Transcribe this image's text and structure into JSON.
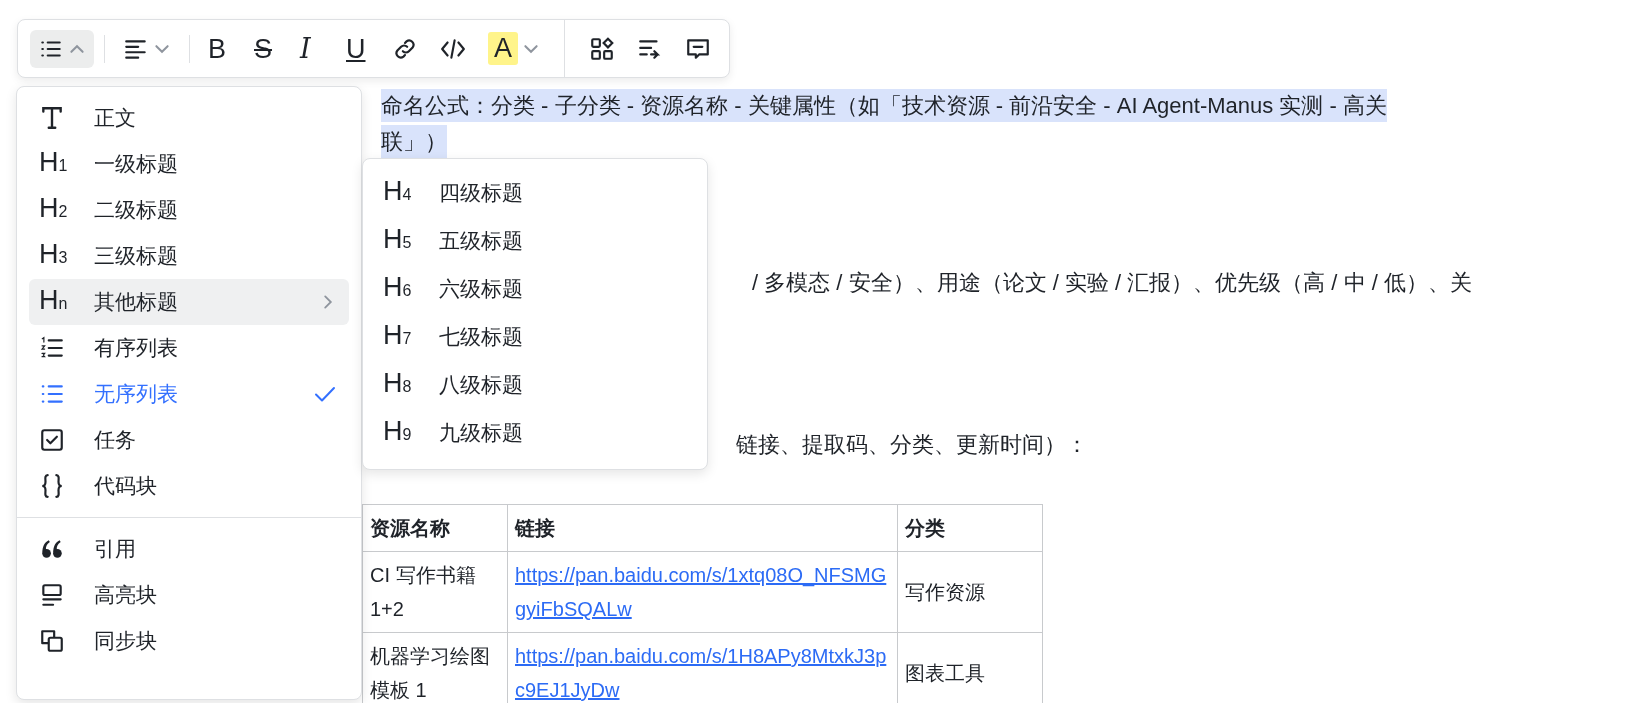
{
  "toolbar": {
    "groups": [
      [
        {
          "kind": "bullet-list",
          "active": true,
          "caret": true,
          "open": true
        }
      ],
      [
        {
          "kind": "align-left",
          "active": false,
          "caret": true,
          "open": false
        }
      ],
      [
        {
          "kind": "bold",
          "label": "B",
          "active": false
        },
        {
          "kind": "strike",
          "label": "S",
          "active": false
        },
        {
          "kind": "italic",
          "label": "I",
          "active": false
        },
        {
          "kind": "underline",
          "label": "U",
          "active": false
        },
        {
          "kind": "link",
          "active": false
        },
        {
          "kind": "code",
          "active": false
        },
        {
          "kind": "highlight",
          "label": "A",
          "active": false,
          "caret": true,
          "open": false
        }
      ],
      [
        {
          "kind": "blocks",
          "active": false
        },
        {
          "kind": "wrap",
          "active": false
        },
        {
          "kind": "comment",
          "active": false
        }
      ]
    ]
  },
  "document": {
    "selected_lines": [
      "命名公式：分类 - 子分类 - 资源名称 - 关键属性（如「技术资源 - 前沿安全 - AI Agent-Manus 实测 - 高关",
      "联」）"
    ],
    "partial_line": "/ 多模态 / 安全）、用途（论文 / 实验 / 汇报）、优先级（高 / 中 / 低）、关",
    "partial_line_2": "链接、提取码、分类、更新时间）：",
    "table": {
      "columns": [
        "资源名称",
        "链接",
        "分类"
      ],
      "rows": [
        [
          "CI 写作书籍 1+2",
          "https://pan.baidu.com/s/1xtq08O_NFSMGgyiFbSQALw",
          "写作资源"
        ],
        [
          "机器学习绘图模板 1",
          "https://pan.baidu.com/s/1H8APy8MtxkJ3pc9EJ1JyDw",
          "图表工具"
        ]
      ]
    }
  },
  "block_menu": {
    "sections": [
      [
        {
          "kind": "text",
          "label": "正文",
          "selected": false,
          "hovered": false
        },
        {
          "kind": "heading",
          "glyph": "H",
          "sub": "1",
          "label": "一级标题",
          "selected": false,
          "hovered": false
        },
        {
          "kind": "heading",
          "glyph": "H",
          "sub": "2",
          "label": "二级标题",
          "selected": false,
          "hovered": false
        },
        {
          "kind": "heading",
          "glyph": "H",
          "sub": "3",
          "label": "三级标题",
          "selected": false,
          "hovered": false
        },
        {
          "kind": "heading",
          "glyph": "H",
          "sub": "n",
          "label": "其他标题",
          "selected": false,
          "hovered": true,
          "expanded": true
        },
        {
          "kind": "ordered",
          "label": "有序列表",
          "selected": false,
          "hovered": false
        },
        {
          "kind": "bullet",
          "label": "无序列表",
          "selected": true,
          "hovered": false
        },
        {
          "kind": "task",
          "label": "任务",
          "selected": false,
          "hovered": false
        },
        {
          "kind": "code",
          "label": "代码块",
          "selected": false,
          "hovered": false
        }
      ],
      [
        {
          "kind": "quote",
          "label": "引用",
          "selected": false,
          "hovered": false
        },
        {
          "kind": "callout",
          "label": "高亮块",
          "selected": false,
          "hovered": false
        },
        {
          "kind": "sync",
          "label": "同步块",
          "selected": false,
          "hovered": false
        }
      ]
    ]
  },
  "heading_submenu": {
    "items": [
      {
        "glyph": "H",
        "sub": "4",
        "label": "四级标题",
        "selected": false
      },
      {
        "glyph": "H",
        "sub": "5",
        "label": "五级标题",
        "selected": false
      },
      {
        "glyph": "H",
        "sub": "6",
        "label": "六级标题",
        "selected": false
      },
      {
        "glyph": "H",
        "sub": "7",
        "label": "七级标题",
        "selected": false
      },
      {
        "glyph": "H",
        "sub": "8",
        "label": "八级标题",
        "selected": false
      },
      {
        "glyph": "H",
        "sub": "9",
        "label": "九级标题",
        "selected": false
      }
    ]
  }
}
